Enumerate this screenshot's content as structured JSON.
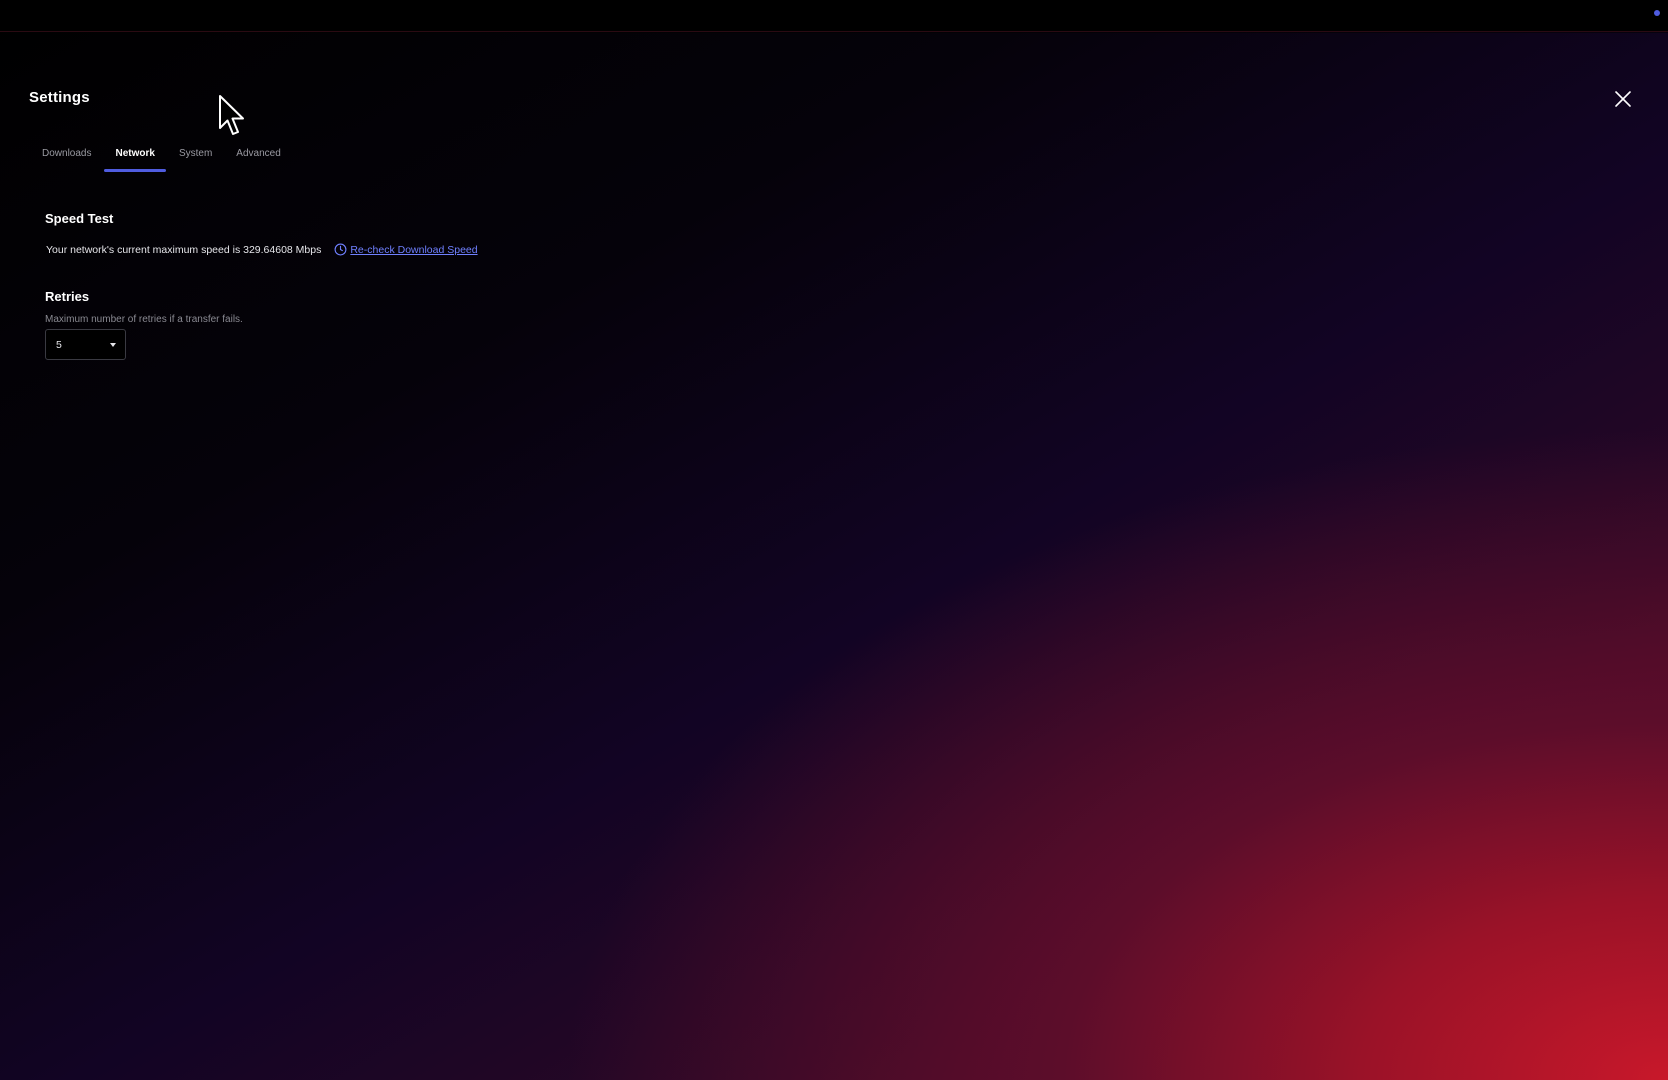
{
  "settings": {
    "title": "Settings",
    "close_icon": "close-icon"
  },
  "tabs": [
    {
      "label": "Downloads",
      "active": false
    },
    {
      "label": "Network",
      "active": true
    },
    {
      "label": "System",
      "active": false
    },
    {
      "label": "Advanced",
      "active": false
    }
  ],
  "speed_test": {
    "heading": "Speed Test",
    "description": "Your network's current maximum speed is 329.64608 Mbps",
    "recheck_label": "Re-check Download Speed",
    "recheck_icon": "clock-icon"
  },
  "retries": {
    "heading": "Retries",
    "description": "Maximum number of retries if a transfer fails.",
    "selected_value": "5"
  },
  "colors": {
    "accent": "#4f5ce0",
    "link": "#6f80ff",
    "background_gradient_end": "#c8182a"
  }
}
